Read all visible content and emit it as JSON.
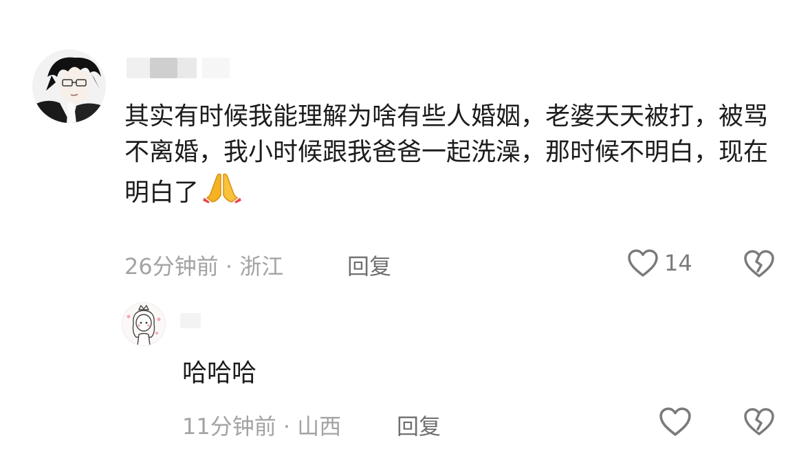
{
  "comment": {
    "text": "其实有时候我能理解为啥有些人婚姻，老婆天天被打，被骂不离婚，我小时候跟我爸爸一起洗澡，那时候不明白，现在明白了",
    "emoji_icon": "folded-hands-emoji",
    "time_location": "26分钟前 · 浙江",
    "reply_label": "回复",
    "like_count": "14",
    "like_icon": "heart-outline-icon",
    "dislike_icon": "broken-heart-icon"
  },
  "reply": {
    "text": "哈哈哈",
    "time_location": "11分钟前 · 山西",
    "reply_label": "回复",
    "like_icon": "heart-outline-icon",
    "dislike_icon": "broken-heart-icon"
  },
  "colors": {
    "text": "#1c1c1c",
    "meta": "#a3a3a3",
    "icon": "#7a7a7a",
    "emoji": "#f5b323"
  }
}
